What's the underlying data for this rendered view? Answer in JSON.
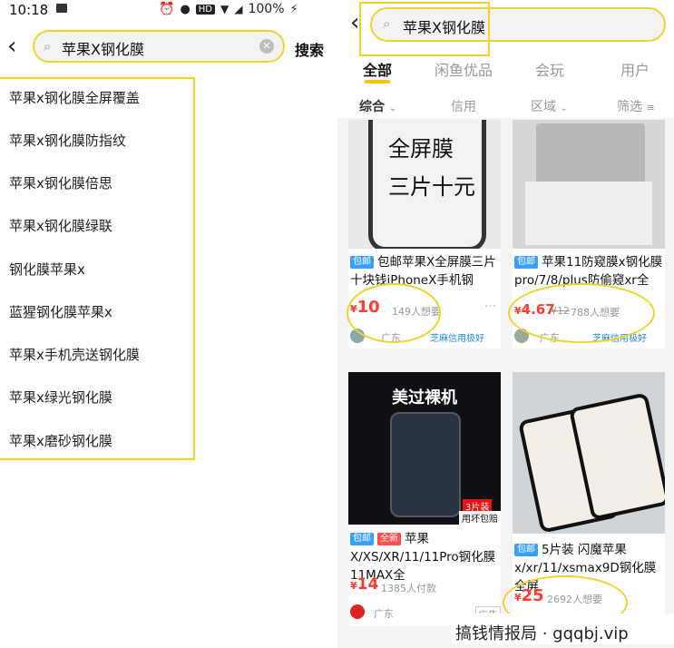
{
  "left": {
    "status_time": "10:18",
    "status_right": "100%",
    "status_badge": "HD",
    "search_text": "苹果X钢化膜",
    "search_button": "搜索",
    "suggestions": [
      "苹果x钢化膜全屏覆盖",
      "苹果x钢化膜防指纹",
      "苹果x钢化膜倍思",
      "苹果x钢化膜绿联",
      "钢化膜苹果x",
      "蓝猩钢化膜苹果x",
      "苹果x手机壳送钢化膜",
      "苹果x绿光钢化膜",
      "苹果x磨砂钢化膜"
    ]
  },
  "right": {
    "search_text": "苹果X钢化膜",
    "tabs": [
      "全部",
      "闲鱼优品",
      "会玩",
      "用户"
    ],
    "filters": [
      "综合",
      "信用",
      "区域",
      "筛选"
    ],
    "cards": [
      {
        "img_text_1": "全屏膜",
        "img_text_2": "三片十元",
        "tags": [
          "包邮"
        ],
        "title": "包邮苹果X全屏膜三片十块钱iPhoneX手机钢",
        "price": "10",
        "price_old": "",
        "want": "149人想要",
        "location": "广东",
        "credit": "芝麻信用极好"
      },
      {
        "img_text_1": "",
        "img_text_2": "",
        "tags": [
          "包邮"
        ],
        "title": "苹果11防窥膜x钢化膜pro/7/8/plus防偷窥xr全",
        "price": "4.67",
        "price_old": "¥12",
        "want": "788人想要",
        "location": "广东",
        "credit": "芝麻信用极好"
      },
      {
        "img_text_1": "美过裸机",
        "img_text_2": "3片装",
        "img_text_3": "用坏包赔",
        "tags": [
          "包邮",
          "全新"
        ],
        "title": "苹果X/XS/XR/11/11Pro钢化膜11MAX全",
        "price": "14",
        "price_old": "",
        "want": "1385人付款",
        "location": "广东",
        "ad": "广告"
      },
      {
        "img_text_1": "",
        "img_text_2": "",
        "tags": [
          "包邮"
        ],
        "title": "5片装 闪魔苹果x/xr/11/xsmax9D钢化膜全屏",
        "price": "25",
        "price_old": "",
        "want": "2692人想要",
        "location": "",
        "credit": ""
      }
    ]
  },
  "watermark": "搞钱情报局 · gqqbj.vip",
  "colors": {
    "accent_yellow": "#f0d230",
    "price_red": "#ff3b30",
    "tag_blue": "#3aa0ff"
  }
}
